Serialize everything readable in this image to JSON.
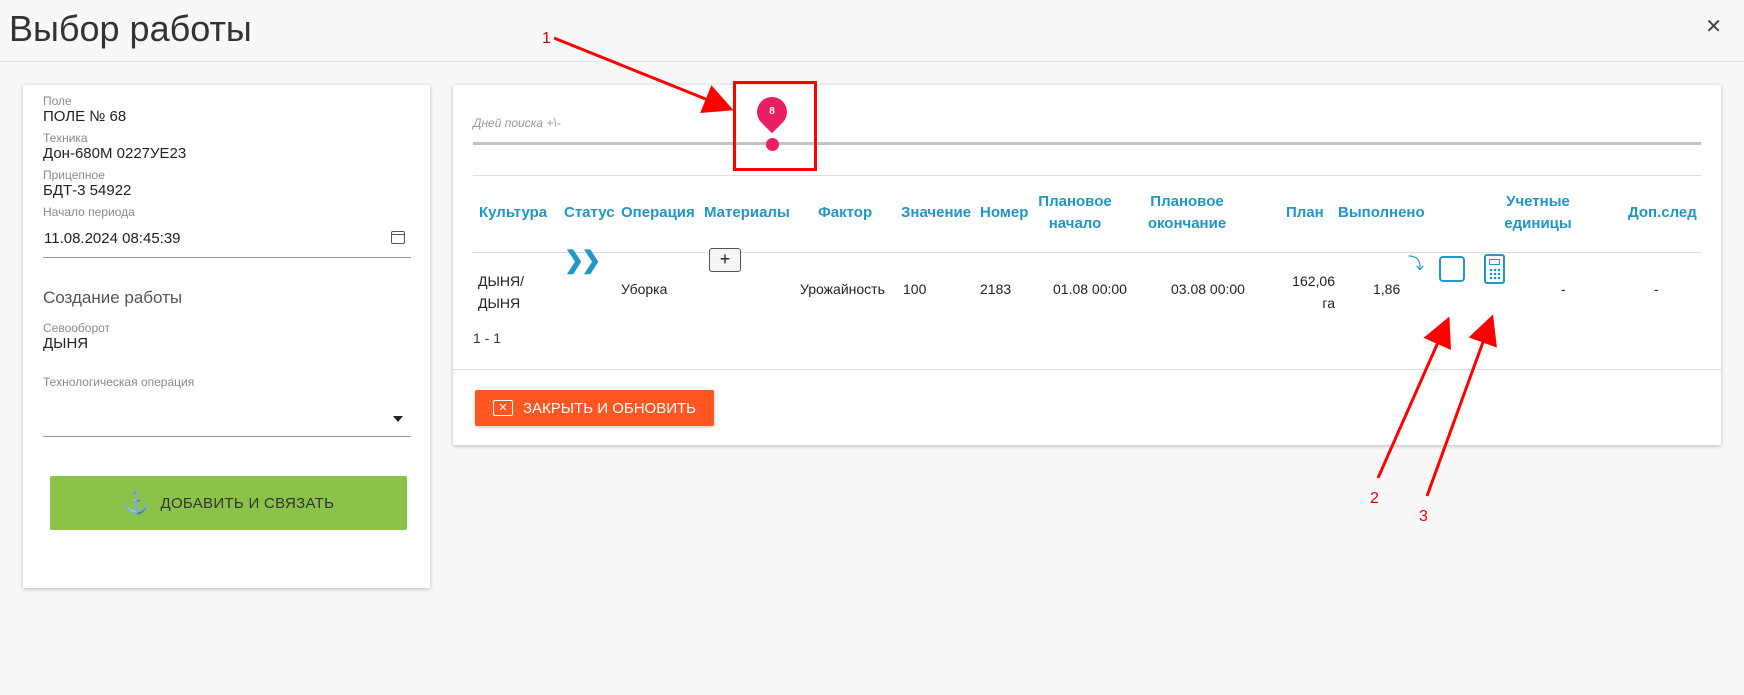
{
  "window": {
    "title": "Выбор работы",
    "close_icon": "✕"
  },
  "left": {
    "field_label": "Поле",
    "field_value": "ПОЛЕ № 68",
    "machine_label": "Техника",
    "machine_value": "Дон-680М 0227УЕ23",
    "trailer_label": "Прицепное",
    "trailer_value": "БДТ-3 54922",
    "period_label": "Начало периода",
    "period_value": "11.08.2024 08:45:39",
    "section_title": "Создание работы",
    "rotation_label": "Севооборот",
    "rotation_value": "ДЫНЯ",
    "operation_label": "Технологическая операция",
    "operation_value": "",
    "add_button": "ДОБАВИТЬ И СВЯЗАТЬ",
    "add_icon": "⚓"
  },
  "right": {
    "slider_label": "Дней поиска +\\-",
    "slider_value": "8",
    "headers": {
      "culture": "Культура",
      "status": "Статус",
      "operation": "Операция",
      "materials": "Материалы",
      "factor": "Фактор",
      "value": "Значение",
      "number": "Номер",
      "plan_start_1": "Плановое",
      "plan_start_2": "начало",
      "plan_end_1": "Плановое",
      "plan_end_2": "окончание",
      "plan": "План",
      "done": "Выполнено",
      "units_1": "Учетные",
      "units_2": "единицы",
      "extra": "Доп.след"
    },
    "row": {
      "culture_1": "ДЫНЯ/",
      "culture_2": "ДЫНЯ",
      "status_icon": "❯❯",
      "operation": "Уборка",
      "materials_btn": "+",
      "factor": "Урожайность",
      "value": "100",
      "number": "2183",
      "plan_start": "01.08 00:00",
      "plan_end": "03.08 00:00",
      "plan_1": "162,06",
      "plan_2": "га",
      "done": "1,86",
      "done_arrow": "⤵",
      "units": "-",
      "extra": "-"
    },
    "pager": "1 - 1",
    "close_button": "ЗАКРЫТЬ И ОБНОВИТЬ",
    "close_icon": "✕"
  },
  "annotations": {
    "a1": "1",
    "a2": "2",
    "a3": "3"
  },
  "colors": {
    "accent_blue": "#2196c8",
    "slider_pink": "#e91e63",
    "green": "#8bc34a",
    "orange": "#ff5722",
    "annotation_red": "#ff0000"
  }
}
